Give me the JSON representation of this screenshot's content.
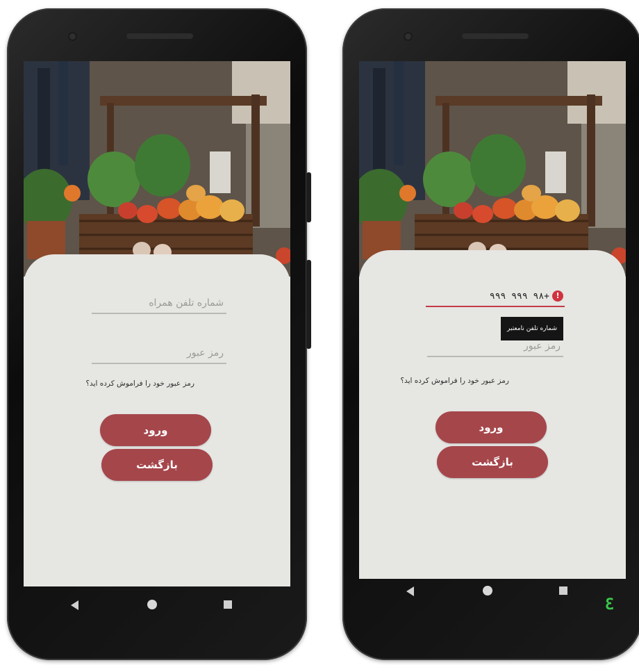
{
  "left_screen": {
    "phone_placeholder": "شماره تلفن همراه",
    "password_placeholder": "رمز عبور",
    "forgot_password": "رمز عبور خود را فراموش کرده اید؟",
    "login_button": "ورود",
    "back_button": "بازگشت"
  },
  "right_screen": {
    "phone_value": "+٩٨ ٩٩٩ ٩٩٩",
    "error_tooltip": "شماره تلفن نامعتبر",
    "password_placeholder": "رمز عبور",
    "forgot_password": "رمز عبور خود را فراموش کرده اید؟",
    "login_button": "ورود",
    "back_button": "بازگشت"
  },
  "corner_glyph": "3",
  "colors": {
    "button": "#a5464b",
    "error": "#c33c4a",
    "card": "#e6e6e3"
  },
  "icons": [
    "error-icon",
    "nav-back-icon",
    "nav-home-icon",
    "nav-recents-icon"
  ]
}
